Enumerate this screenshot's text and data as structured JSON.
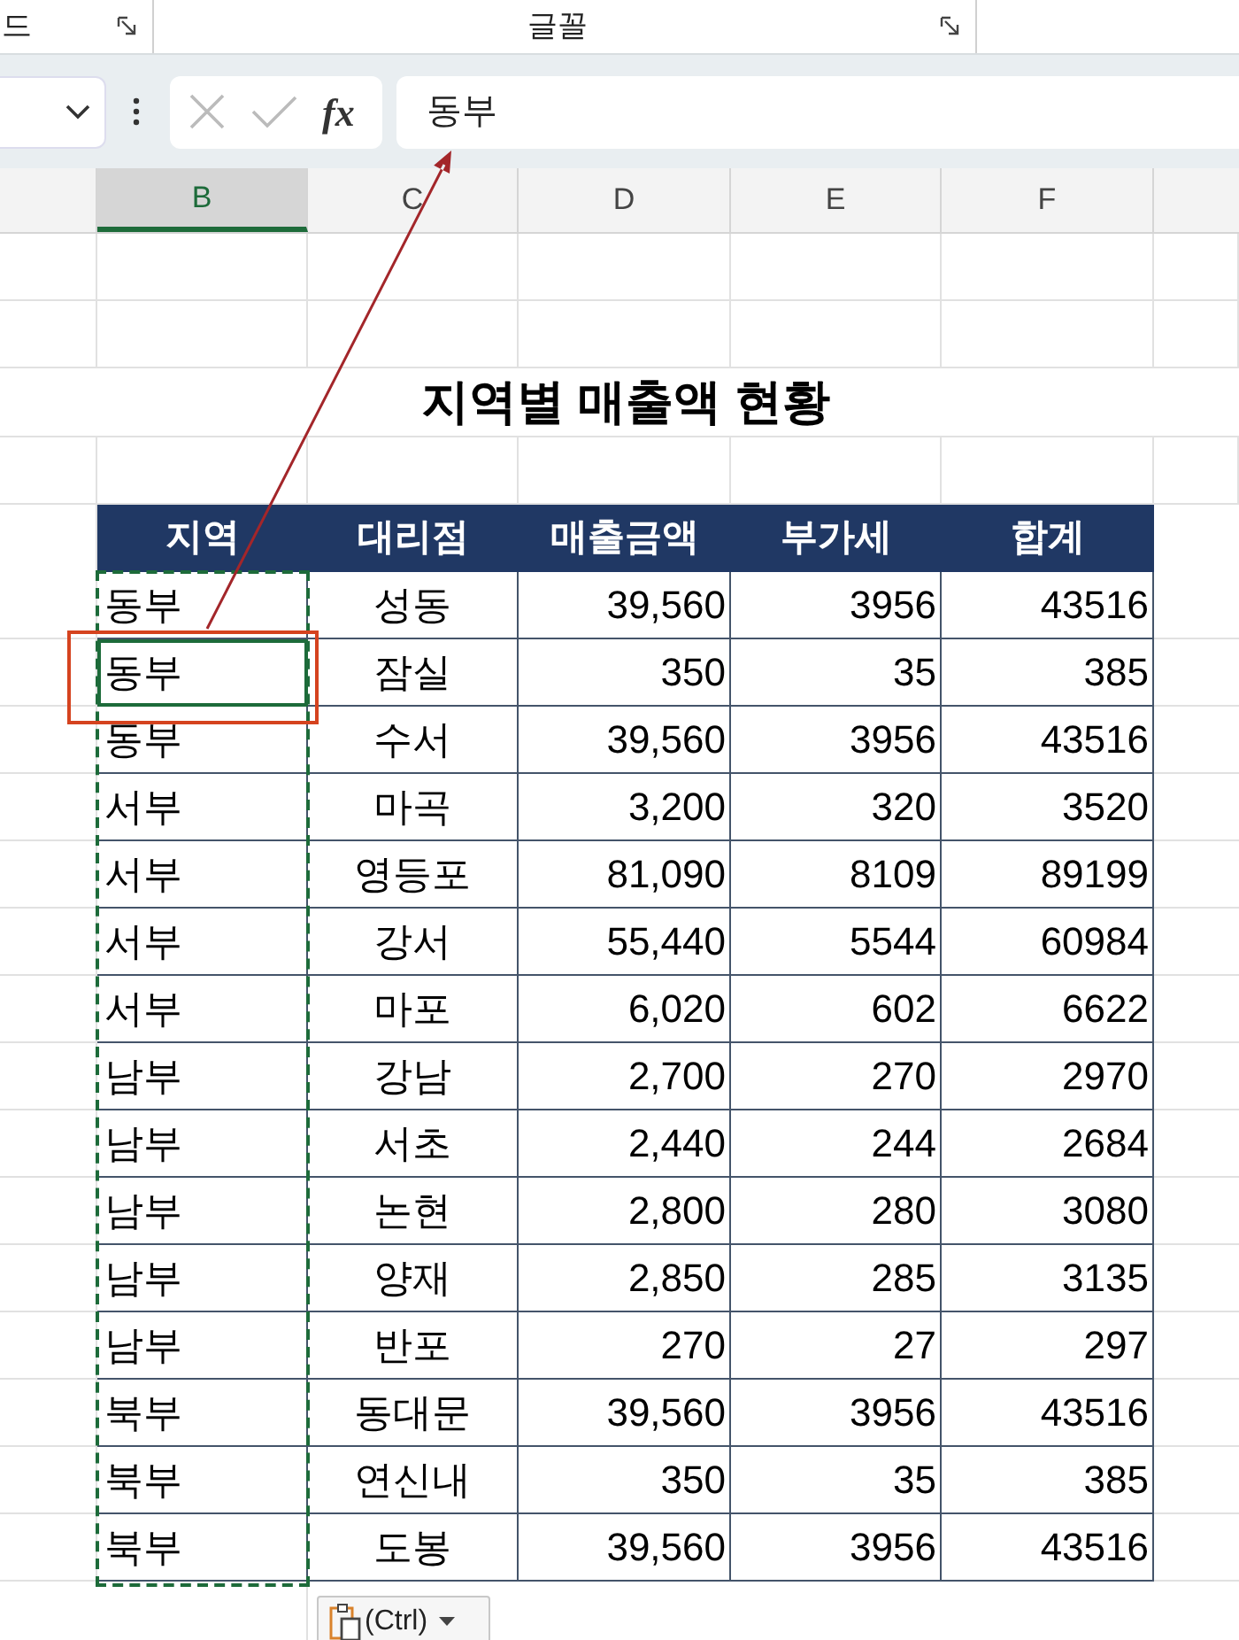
{
  "ribbon": {
    "groups": [
      {
        "label": "드"
      },
      {
        "label": "글꼴"
      }
    ]
  },
  "formula_bar": {
    "function_label": "fx",
    "content": "동부"
  },
  "column_headers": [
    {
      "label": "B",
      "selected": true
    },
    {
      "label": "C",
      "selected": false
    },
    {
      "label": "D",
      "selected": false
    },
    {
      "label": "E",
      "selected": false
    },
    {
      "label": "F",
      "selected": false
    }
  ],
  "sheet_title": "지역별 매출액 현황",
  "table": {
    "columns": [
      "지역",
      "대리점",
      "매출금액",
      "부가세",
      "합계"
    ],
    "rows": [
      {
        "cells": [
          "동부",
          "성동",
          "39,560",
          "3956",
          "43516"
        ],
        "selected": false
      },
      {
        "cells": [
          "동부",
          "잠실",
          "350",
          "35",
          "385"
        ],
        "selected": true
      },
      {
        "cells": [
          "동부",
          "수서",
          "39,560",
          "3956",
          "43516"
        ],
        "selected": false
      },
      {
        "cells": [
          "서부",
          "마곡",
          "3,200",
          "320",
          "3520"
        ],
        "selected": false
      },
      {
        "cells": [
          "서부",
          "영등포",
          "81,090",
          "8109",
          "89199"
        ],
        "selected": false
      },
      {
        "cells": [
          "서부",
          "강서",
          "55,440",
          "5544",
          "60984"
        ],
        "selected": false
      },
      {
        "cells": [
          "서부",
          "마포",
          "6,020",
          "602",
          "6622"
        ],
        "selected": false
      },
      {
        "cells": [
          "남부",
          "강남",
          "2,700",
          "270",
          "2970"
        ],
        "selected": false
      },
      {
        "cells": [
          "남부",
          "서초",
          "2,440",
          "244",
          "2684"
        ],
        "selected": false
      },
      {
        "cells": [
          "남부",
          "논현",
          "2,800",
          "280",
          "3080"
        ],
        "selected": false
      },
      {
        "cells": [
          "남부",
          "양재",
          "2,850",
          "285",
          "3135"
        ],
        "selected": false
      },
      {
        "cells": [
          "남부",
          "반포",
          "270",
          "27",
          "297"
        ],
        "selected": false
      },
      {
        "cells": [
          "북부",
          "동대문",
          "39,560",
          "3956",
          "43516"
        ],
        "selected": false
      },
      {
        "cells": [
          "북부",
          "연신내",
          "350",
          "35",
          "385"
        ],
        "selected": false
      },
      {
        "cells": [
          "북부",
          "도봉",
          "39,560",
          "3956",
          "43516"
        ],
        "selected": false
      }
    ]
  },
  "paste_options": {
    "label": "(Ctrl)"
  }
}
